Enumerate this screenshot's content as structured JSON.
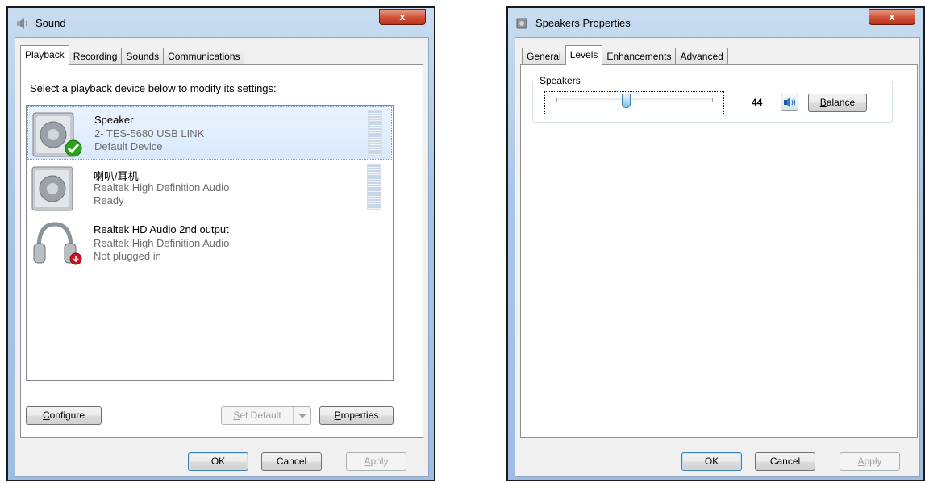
{
  "sound": {
    "title": "Sound",
    "close": "x",
    "tabs": [
      "Playback",
      "Recording",
      "Sounds",
      "Communications"
    ],
    "prompt": "Select a playback device below to modify its settings:",
    "devices": [
      {
        "name": "Speaker",
        "line1": "2- TES-5680 USB LINK",
        "line2": "Default Device"
      },
      {
        "name": "喇叭/耳机",
        "line1": "Realtek High Definition Audio",
        "line2": "Ready"
      },
      {
        "name": "Realtek HD Audio 2nd output",
        "line1": "Realtek High Definition Audio",
        "line2": "Not plugged in"
      }
    ],
    "configure_label": "onfigure",
    "configure_key": "C",
    "set_default_label": "et Default",
    "set_default_key": "S",
    "properties_label": "roperties",
    "properties_key": "P",
    "ok": "OK",
    "cancel": "Cancel",
    "apply_key": "A",
    "apply_label": "pply"
  },
  "props": {
    "title": "Speakers Properties",
    "close": "x",
    "tabs": [
      "General",
      "Levels",
      "Enhancements",
      "Advanced"
    ],
    "group_label": "Speakers",
    "level_value": "44",
    "level_fraction": 0.44,
    "balance_key": "B",
    "balance_label": "alance",
    "ok": "OK",
    "cancel": "Cancel",
    "apply_key": "A",
    "apply_label": "pply"
  },
  "colors": {
    "selection": "#d9e9fb",
    "check_green": "#2aa21d",
    "unplugged_red": "#c8141e"
  }
}
